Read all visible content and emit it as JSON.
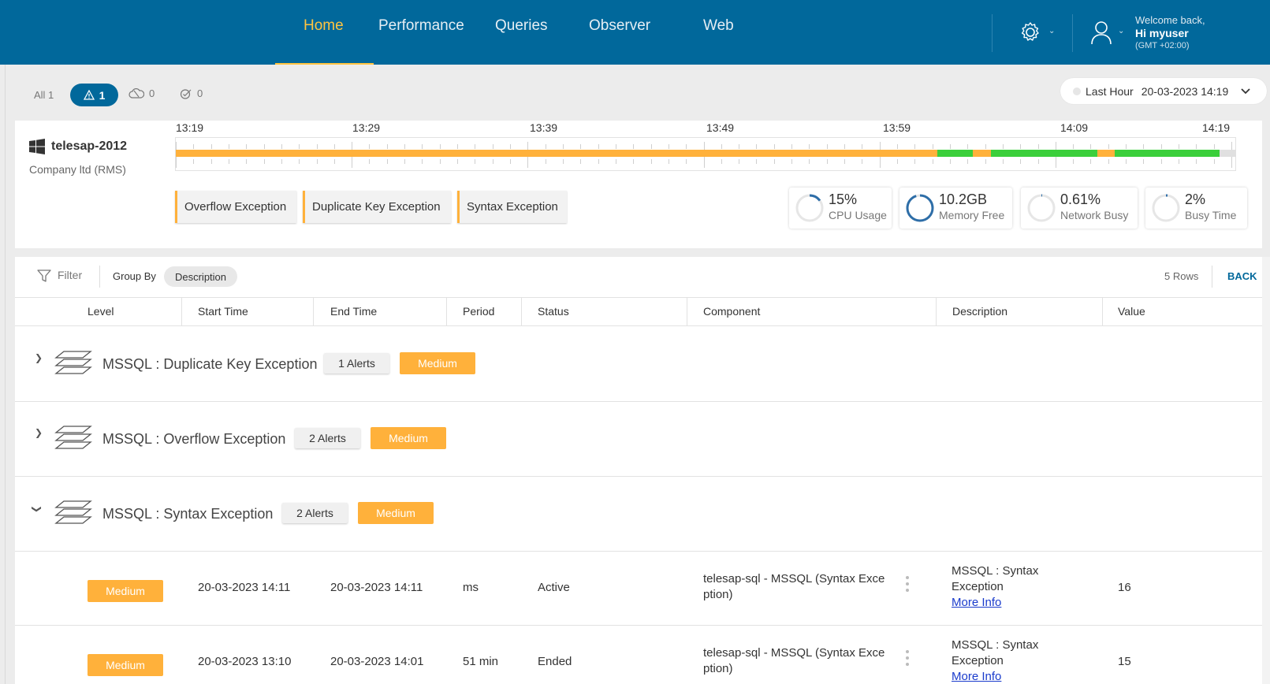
{
  "nav": {
    "items": [
      {
        "label": "Home",
        "active": true
      },
      {
        "label": "Performance"
      },
      {
        "label": "Queries"
      },
      {
        "label": "Observer"
      },
      {
        "label": "Web"
      }
    ],
    "accent_color": "#ffc440",
    "bg_color": "#01689b"
  },
  "user": {
    "welcome": "Welcome back,",
    "greeting": "Hi myuser",
    "timezone": "(GMT +02:00)"
  },
  "filters": {
    "all": "All 1",
    "alerts": "1",
    "cloud": "0",
    "resolved": "0"
  },
  "time_selector": {
    "range": "Last Hour",
    "datetime": "20-03-2023 14:19"
  },
  "host": {
    "name": "telesap-2012",
    "company": "Company ltd (RMS)",
    "icon": "windows-icon"
  },
  "timeline": {
    "labels": [
      "13:19",
      "13:29",
      "13:39",
      "13:49",
      "13:59",
      "14:09",
      "14:19"
    ],
    "status_colors": {
      "warning": "#ffb13b",
      "ok": "#3bcf3b",
      "none": "#e0e0e0"
    }
  },
  "exceptions": [
    "Overflow Exception",
    "Duplicate Key Exception",
    "Syntax Exception"
  ],
  "metrics": [
    {
      "value": "15%",
      "label": "CPU Usage",
      "percent": 15
    },
    {
      "value": "10.2GB",
      "label": "Memory Free",
      "percent": 95
    },
    {
      "value": "0.61%",
      "label": "Network Busy",
      "percent": 1
    },
    {
      "value": "2%",
      "label": "Busy Time",
      "percent": 2
    }
  ],
  "toolbar": {
    "filter": "Filter",
    "group_by": "Group By",
    "group_value": "Description",
    "rows": "5 Rows",
    "back": "BACK"
  },
  "columns": [
    "Level",
    "Start Time",
    "End Time",
    "Period",
    "Status",
    "Component",
    "Description",
    "Value"
  ],
  "groups": [
    {
      "title": "MSSQL : Duplicate Key Exception",
      "alerts": "1 Alerts",
      "level": "Medium",
      "expanded": false
    },
    {
      "title": "MSSQL : Overflow Exception",
      "alerts": "2 Alerts",
      "level": "Medium",
      "expanded": false
    },
    {
      "title": "MSSQL : Syntax Exception",
      "alerts": "2 Alerts",
      "level": "Medium",
      "expanded": true
    }
  ],
  "rows": [
    {
      "level": "Medium",
      "start": "20-03-2023 14:11",
      "end": "20-03-2023 14:11",
      "period": "ms",
      "status": "Active",
      "component_1": "telesap-sql - MSSQL (Syntax Exce",
      "component_2": "ption)",
      "desc_1": "MSSQL : Syntax",
      "desc_2": "Exception",
      "more": "More Info",
      "value": "16"
    },
    {
      "level": "Medium",
      "start": "20-03-2023 13:10",
      "end": "20-03-2023 14:01",
      "period": "51 min",
      "status": "Ended",
      "component_1": "telesap-sql - MSSQL (Syntax Exce",
      "component_2": "ption)",
      "desc_1": "MSSQL : Syntax",
      "desc_2": "Exception",
      "more": "More Info",
      "value": "15"
    }
  ]
}
